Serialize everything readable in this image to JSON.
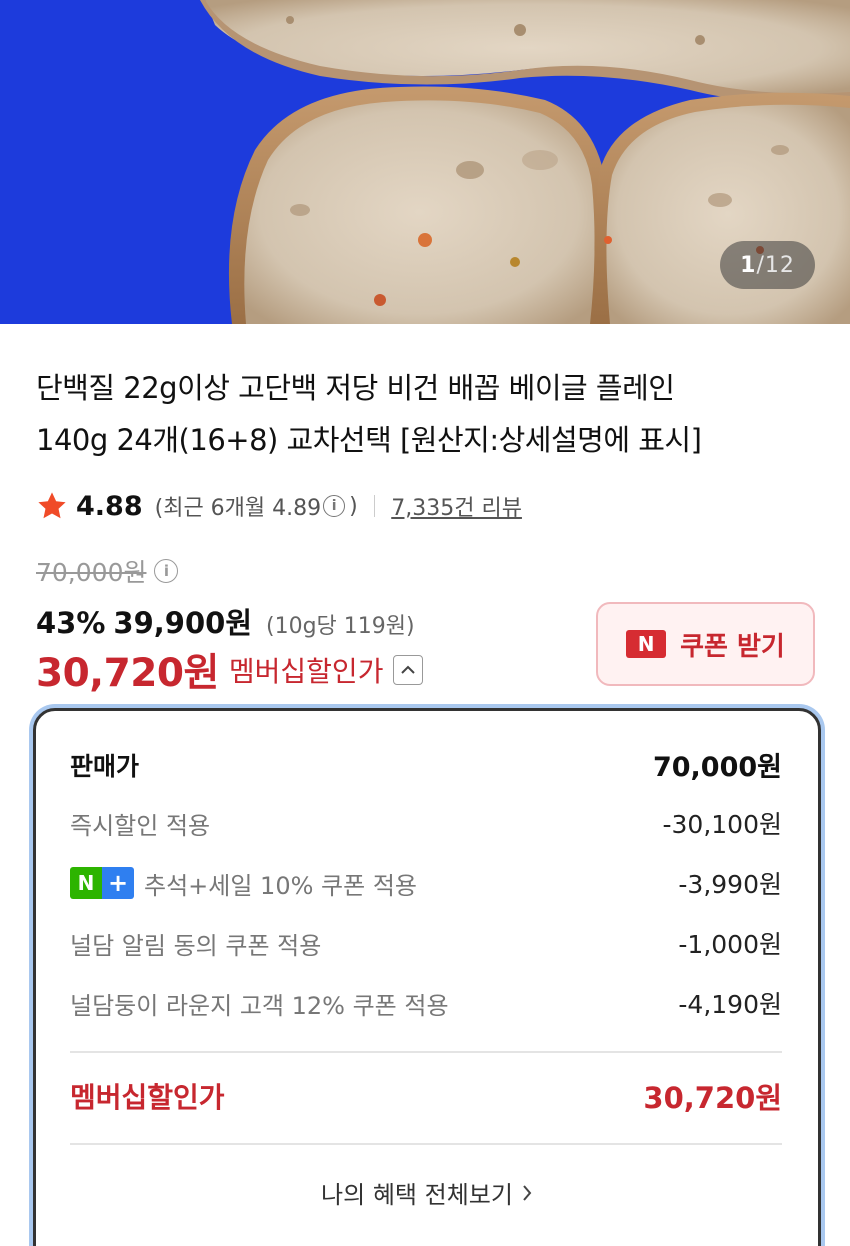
{
  "gallery": {
    "current": "1",
    "separator": "/",
    "total": "12"
  },
  "product": {
    "title_line1": "단백질 22g이상 고단백 저당 비건 배꼽 베이글 플레인",
    "title_line2": "140g 24개(16+8) 교차선택 [원산지:상세설명에 표시]"
  },
  "rating": {
    "score": "4.88",
    "recent_prefix": "(최근 6개월 4.89",
    "recent_suffix": ")",
    "review_count": "7,335건 리뷰"
  },
  "price": {
    "original": "70,000원",
    "discount_rate": "43%",
    "sale_price": "39,900원",
    "unit_price": "(10g당 119원)",
    "member_price": "30,720원",
    "member_label": "멤버십할인가"
  },
  "coupon": {
    "badge": "N",
    "label": "쿠폰 받기"
  },
  "breakdown": {
    "sale_price_label": "판매가",
    "sale_price_value": "70,000원",
    "items": [
      {
        "label": "즉시할인 적용",
        "value": "-30,100원"
      },
      {
        "label": "추석+세일 10% 쿠폰 적용",
        "value": "-3,990원"
      },
      {
        "label": "널담 알림 동의 쿠폰 적용",
        "value": "-1,000원"
      },
      {
        "label": "널담둥이 라운지 고객 12% 쿠폰 적용",
        "value": "-4,190원"
      }
    ],
    "total_label": "멤버십할인가",
    "total_value": "30,720원",
    "view_all": "나의 혜택 전체보기"
  },
  "badges": {
    "naver_n": "N",
    "naver_plus": "+"
  },
  "colors": {
    "accent_red": "#c7272f",
    "hero_blue": "#1d3bdc",
    "panel_focus": "#a9c8ef"
  }
}
